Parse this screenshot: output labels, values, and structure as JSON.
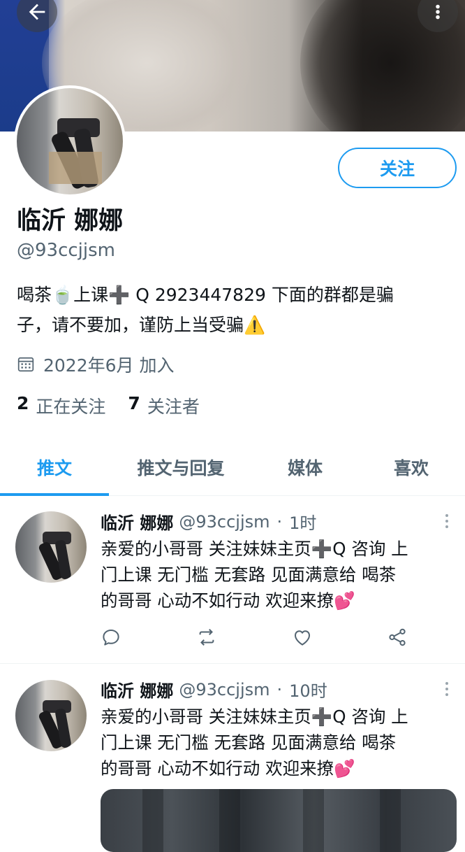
{
  "colors": {
    "accent": "#1d9bf0",
    "secondary_text": "#536471",
    "primary_text": "#0f1419",
    "heart_emoji": "#e0245e"
  },
  "header": {
    "back_icon": "arrow-left-icon",
    "more_icon": "more-vertical-icon"
  },
  "profile": {
    "display_name": "临沂 娜娜",
    "handle": "@93ccjjsm",
    "follow_label": "关注",
    "bio_line1": "喝茶🍵上课➕ Q 2923447829 下面的群都是骗",
    "bio_line2": "子，请不要加，谨防上当受骗⚠️",
    "joined": "2022年6月 加入",
    "following_count": "2",
    "following_label": "正在关注",
    "followers_count": "7",
    "followers_label": "关注者"
  },
  "tabs": [
    {
      "label": "推文",
      "active": true
    },
    {
      "label": "推文与回复",
      "active": false
    },
    {
      "label": "媒体",
      "active": false
    },
    {
      "label": "喜欢",
      "active": false
    }
  ],
  "tweets": [
    {
      "name": "临沂 娜娜",
      "handle": "@93ccjjsm",
      "dot": "·",
      "time": "1时",
      "line1": "亲爱的小哥哥 关注妹妹主页➕Q 咨询 上",
      "line2": "门上课  无门槛  无套路 见面满意给 喝茶",
      "line3": "的哥哥 心动不如行动  欢迎来撩💕"
    },
    {
      "name": "临沂 娜娜",
      "handle": "@93ccjjsm",
      "dot": "·",
      "time": "10时",
      "line1": "亲爱的小哥哥 关注妹妹主页➕Q 咨询 上",
      "line2": "门上课  无门槛  无套路 见面满意给 喝茶",
      "line3": "的哥哥 心动不如行动  欢迎来撩💕"
    }
  ]
}
